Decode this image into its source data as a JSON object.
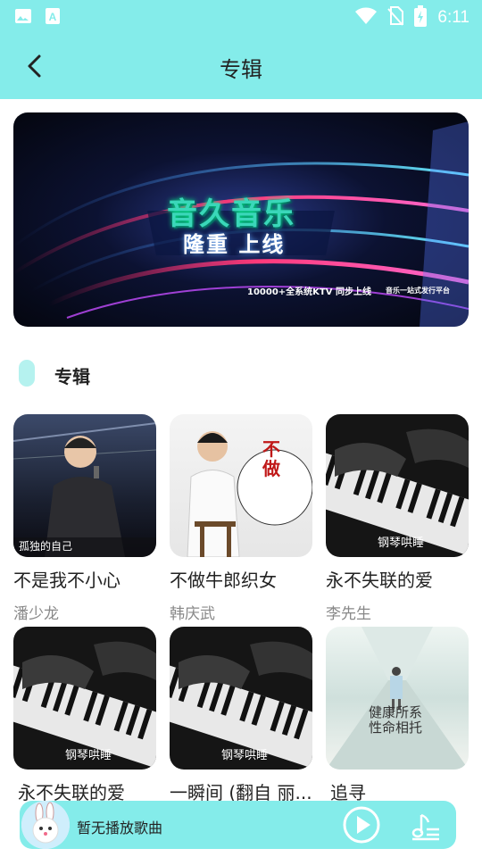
{
  "status": {
    "time": "6:11"
  },
  "header": {
    "title": "专辑"
  },
  "banner": {
    "title": "音久音乐",
    "subtitle": "隆重 上线",
    "footer_left": "10000+全系统KTV  同步上线",
    "footer_right": "音乐一站式发行平台"
  },
  "section": {
    "title": "专辑"
  },
  "albums": [
    {
      "title": "不是我不小心",
      "artist": "潘少龙",
      "cover": "singer-live",
      "cover_text": "孤独的自己"
    },
    {
      "title": "不做牛郎织女",
      "artist": "韩庆武",
      "cover": "singer-white",
      "cover_text": "不做"
    },
    {
      "title": "永不失联的爱",
      "artist": "李先生",
      "cover": "piano",
      "cover_text": "钢琴哄睡"
    },
    {
      "title": "永不失联的爱",
      "artist": "",
      "cover": "piano",
      "cover_text": "钢琴哄睡"
    },
    {
      "title": "一瞬间 (翻自 丽...",
      "artist": "",
      "cover": "piano",
      "cover_text": "钢琴哄睡"
    },
    {
      "title": "追寻",
      "artist": "",
      "cover": "corridor",
      "cover_text": "健康所系 性命相托"
    }
  ],
  "player": {
    "status_text": "暂无播放歌曲"
  },
  "colors": {
    "accent": "#84ecea",
    "marker": "#b5f2ef"
  }
}
